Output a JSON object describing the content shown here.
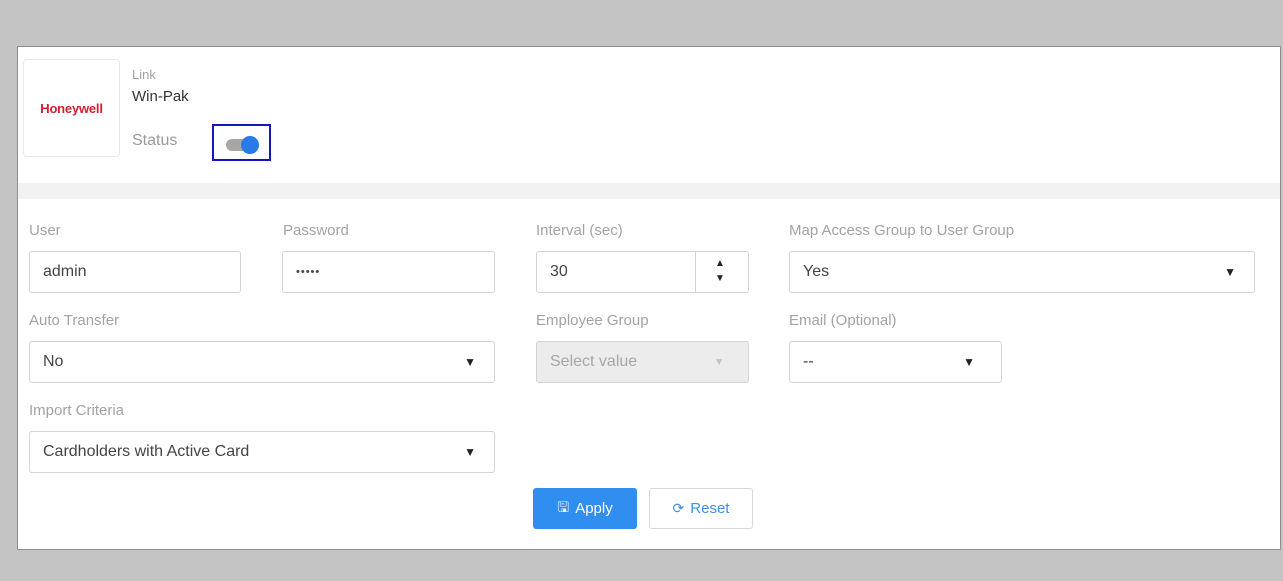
{
  "header": {
    "logo_text": "Honeywell",
    "link_label": "Link",
    "link_value": "Win-Pak",
    "status_label": "Status",
    "status_on": true
  },
  "form": {
    "user": {
      "label": "User",
      "value": "admin"
    },
    "password": {
      "label": "Password",
      "value": "•••••"
    },
    "interval": {
      "label": "Interval (sec)",
      "value": "30"
    },
    "map_access": {
      "label": "Map Access Group to User Group",
      "value": "Yes"
    },
    "auto_transfer": {
      "label": "Auto Transfer",
      "value": "No"
    },
    "employee_group": {
      "label": "Employee Group",
      "placeholder": "Select value"
    },
    "email": {
      "label": "Email (Optional)",
      "value": "--"
    },
    "import_criteria": {
      "label": "Import Criteria",
      "value": "Cardholders with Active Card"
    }
  },
  "buttons": {
    "apply": "Apply",
    "reset": "Reset"
  },
  "icons": {
    "save": "save-icon",
    "refresh": "refresh-icon",
    "caret": "caret-down-icon"
  },
  "colors": {
    "accent": "#2f8ef0",
    "toggle_on": "#2979e8",
    "brand_red": "#d2202f"
  }
}
